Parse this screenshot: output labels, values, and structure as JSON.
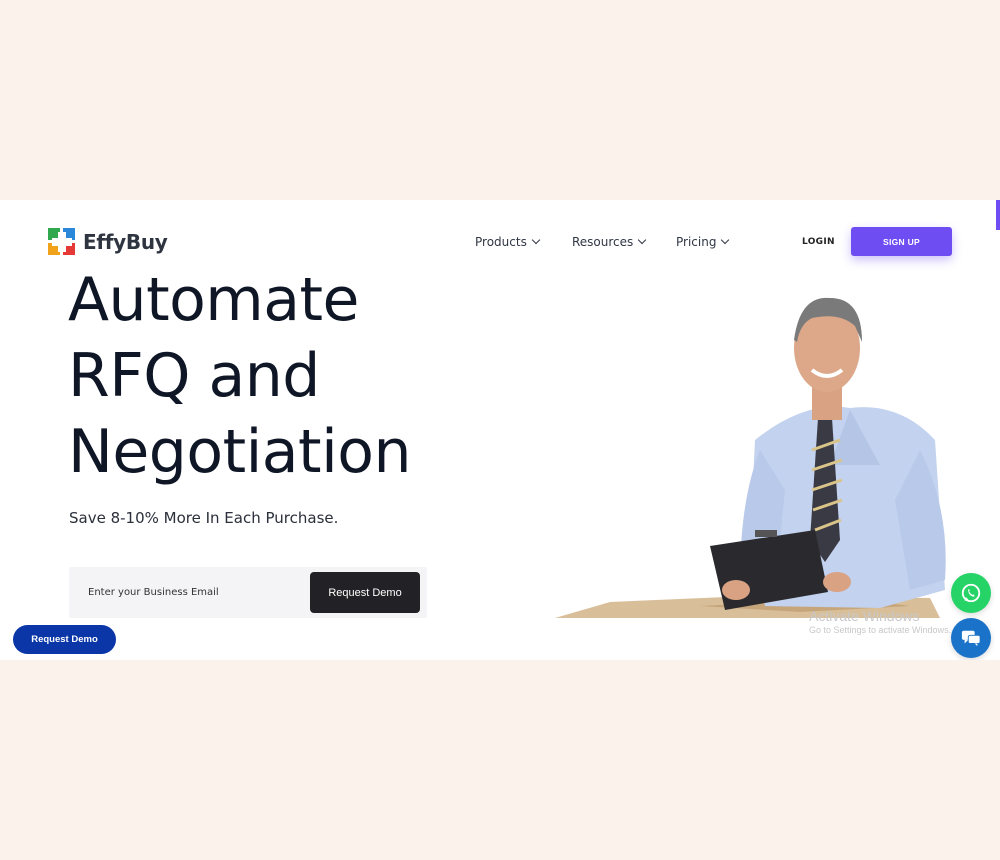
{
  "brand": {
    "name": "EffyBuy"
  },
  "nav": {
    "items": [
      {
        "label": "Products"
      },
      {
        "label": "Resources"
      },
      {
        "label": "Pricing"
      }
    ],
    "login_label": "LOGIN",
    "signup_label": "SIGN UP"
  },
  "hero": {
    "headline": [
      "Automate",
      "RFQ and",
      "Negotiation"
    ],
    "subheading": "Save 8-10% More In Each Purchase.",
    "email_placeholder": "Enter your Business Email",
    "cta_label": "Request Demo"
  },
  "floating": {
    "request_demo_label": "Request Demo"
  },
  "os_watermark": {
    "title": "Activate Windows",
    "subtitle": "Go to Settings to activate Windows."
  },
  "colors": {
    "page_background": "#fbf2ec",
    "accent": "#6e4ef2",
    "headline_highlight": "#fbe8a8",
    "floating_button": "#0a36a8",
    "whatsapp": "#25d366",
    "chat": "#1a73c8"
  },
  "icons": [
    "chevron-down-icon",
    "whatsapp-icon",
    "chat-icon"
  ]
}
